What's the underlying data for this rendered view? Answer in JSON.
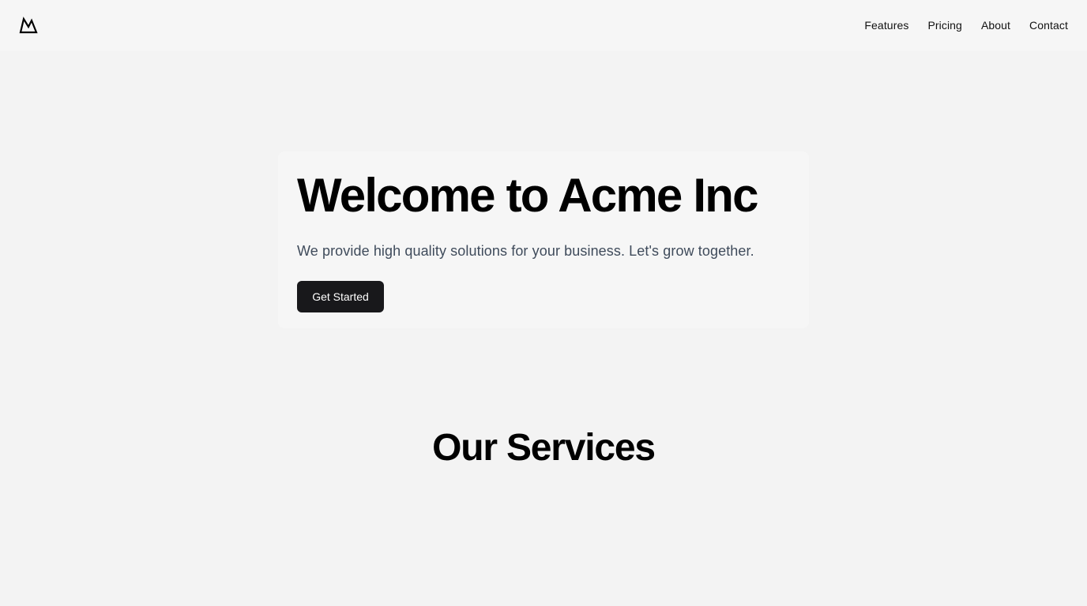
{
  "header": {
    "logo_icon": "mountain-icon",
    "nav": [
      "Features",
      "Pricing",
      "About",
      "Contact"
    ]
  },
  "hero": {
    "title": "Welcome to Acme Inc",
    "subtitle": "We provide high quality solutions for your business. Let's grow together.",
    "cta_label": "Get Started"
  },
  "services": {
    "title": "Our Services"
  },
  "colors": {
    "page_background": "#f3f3f3",
    "header_background": "#f6f6f6",
    "card_background": "#f6f6f6",
    "primary_button": "#18181b",
    "heading_text": "#000000",
    "body_text": "#3f4b5b"
  }
}
